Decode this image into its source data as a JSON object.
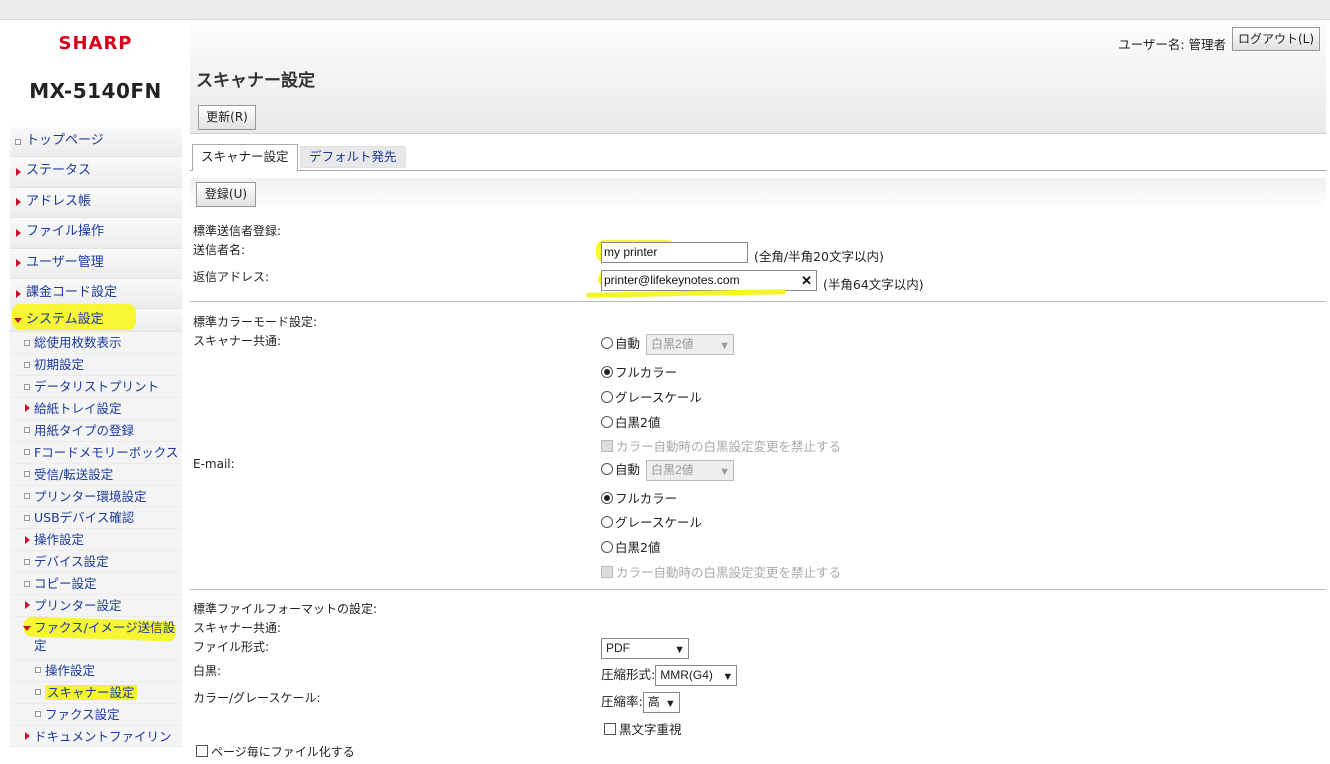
{
  "brand": {
    "logo": "SHARP",
    "model": "MX-5140FN"
  },
  "header": {
    "user_label": "ユーザー名: 管理者",
    "logout_label": "ログアウト(L)",
    "page_title": "スキャナー設定",
    "refresh_label": "更新(R)"
  },
  "nav": {
    "top": "トップページ",
    "status": "ステータス",
    "address": "アドレス帳",
    "file_ops": "ファイル操作",
    "user_mgmt": "ユーザー管理",
    "billing": "課金コード設定",
    "system": "システム設定",
    "sub": {
      "usage": "総使用枚数表示",
      "initial": "初期設定",
      "data_list": "データリストプリント",
      "tray": "給紙トレイ設定",
      "paper_type": "用紙タイプの登録",
      "fcode": "Fコードメモリーボックス",
      "recv": "受信/転送設定",
      "printer_env": "プリンター環境設定",
      "usb": "USBデバイス確認",
      "operation": "操作設定",
      "device": "デバイス設定",
      "copy": "コピー設定",
      "printer": "プリンター設定",
      "fax_image": "ファクス/イメージ送信設定",
      "fax_sub": {
        "operation": "操作設定",
        "scanner": "スキャナー設定",
        "fax": "ファクス設定"
      },
      "docfiling": "ドキュメントファイリン"
    }
  },
  "tabs": {
    "scanner": "スキャナー設定",
    "default_dest": "デフォルト発先"
  },
  "form": {
    "register_label": "登録(U)",
    "sender_section": "標準送信者登録:",
    "sender_name_label": "送信者名:",
    "sender_name_value": "my printer",
    "sender_name_note": "(全角/半角20文字以内)",
    "reply_label": "返信アドレス:",
    "reply_value": "printer@lifekeynotes.com",
    "reply_clear": "✕",
    "reply_note": "(半角64文字以内)",
    "color_section": "標準カラーモード設定:",
    "scanner_common_label": "スキャナー共通:",
    "email_label": "E-mail:",
    "opt_auto": "自動",
    "auto_select": "白黒2値",
    "opt_fullcolor": "フルカラー",
    "opt_gray": "グレースケール",
    "opt_bw": "白黒2値",
    "disable_bw_change": "カラー自動時の白黒設定変更を禁止する",
    "format_section": "標準ファイルフォーマットの設定:",
    "format_scanner_common": "スキャナー共通:",
    "file_type_label": "ファイル形式:",
    "file_type_value": "PDF",
    "bw_label": "白黒:",
    "compression_label": "圧縮形式:",
    "compression_value": "MMR(G4)",
    "color_gray_label": "カラー/グレースケール:",
    "ratio_label": "圧縮率:",
    "ratio_value": "高",
    "black_text_priority": "黒文字重視",
    "per_page_file": "ページ毎にファイル化する"
  }
}
